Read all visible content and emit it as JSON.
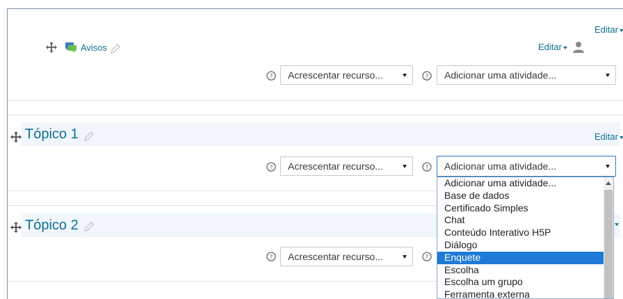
{
  "edit_label": "Editar",
  "announcements": {
    "label": "Avisos"
  },
  "sections": [
    {
      "title": "Tópico 1"
    },
    {
      "title": "Tópico 2"
    }
  ],
  "resource_select": {
    "value": "Acrescentar recurso..."
  },
  "activity_select": {
    "value": "Adicionar uma atividade...",
    "options": [
      "Adicionar uma atividade...",
      "Base de dados",
      "Certificado Simples",
      "Chat",
      "Conteúdo Interativo H5P",
      "Diálogo",
      "Enquete",
      "Escolha",
      "Escolha um grupo",
      "Ferramenta externa"
    ],
    "highlighted": "Enquete"
  },
  "colors": {
    "link": "#0f6e8c",
    "highlight": "#1e7ad6",
    "section_bg": "#f0f6fc"
  },
  "icons": [
    "move-icon",
    "forum-icon",
    "pencil-icon",
    "help-icon",
    "user-icon"
  ]
}
